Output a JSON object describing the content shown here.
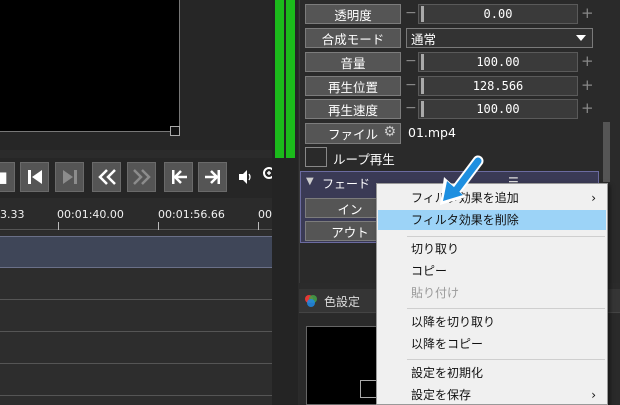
{
  "properties": {
    "opacity": {
      "label": "透明度",
      "value": "0.00"
    },
    "blend_mode": {
      "label": "合成モード",
      "value": "通常"
    },
    "volume": {
      "label": "音量",
      "value": "100.00"
    },
    "playback_position": {
      "label": "再生位置",
      "value": "128.566"
    },
    "playback_speed": {
      "label": "再生速度",
      "value": "100.00"
    },
    "file": {
      "label": "ファイル",
      "value": "01.mp4"
    },
    "loop": {
      "label": "ループ再生"
    }
  },
  "fade": {
    "title": "フェード",
    "in_label": "イン",
    "out_label": "アウト"
  },
  "timeline": {
    "ticks": [
      "3.33",
      "00:01:40.00",
      "00:01:56.66",
      "00"
    ]
  },
  "color_panel": {
    "title": "色設定"
  },
  "context_menu": {
    "items": [
      {
        "label": "フィルタ効果を追加",
        "submenu": true
      },
      {
        "label": "フィルタ効果を削除",
        "highlighted": true
      },
      {
        "label": "切り取り"
      },
      {
        "label": "コピー"
      },
      {
        "label": "貼り付け",
        "disabled": true
      },
      {
        "label": "以降を切り取り"
      },
      {
        "label": "以降をコピー"
      },
      {
        "label": "設定を初期化"
      },
      {
        "label": "設定を保存",
        "submenu": true
      }
    ]
  },
  "icons": {
    "stop": "stop-icon",
    "prev-frame": "step-back-icon",
    "next-frame": "step-forward-icon",
    "rewind": "rewind-icon",
    "fast-forward": "fast-forward-icon",
    "go-start": "skip-start-icon",
    "go-end": "skip-end-icon",
    "volume": "speaker-icon",
    "zoom": "zoom-icon",
    "gear": "gear-icon",
    "cursor": "arrow-pointer-icon"
  },
  "colors": {
    "meter_green": "#1bba1b",
    "menu_highlight": "#9cd3f7",
    "fade_block": "#3a3a55",
    "cursor_blue": "#1e8fe0"
  }
}
